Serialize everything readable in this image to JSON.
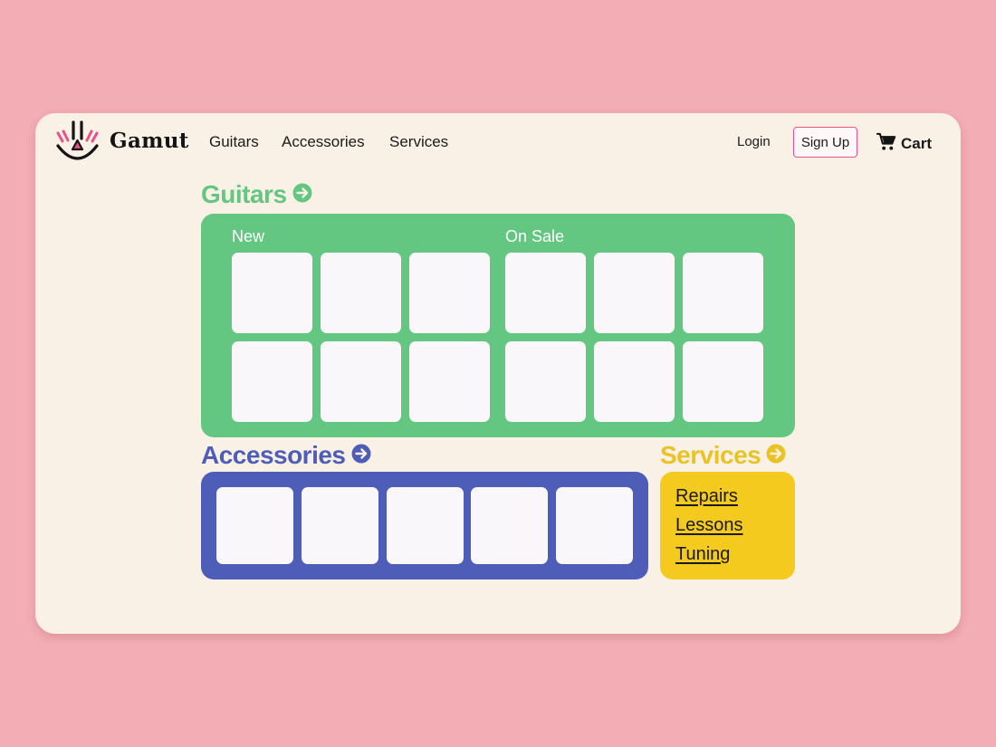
{
  "header": {
    "brand": "Gamut",
    "nav": [
      "Guitars",
      "Accessories",
      "Services"
    ],
    "login_label": "Login",
    "signup_label": "Sign Up",
    "cart_label": "Cart"
  },
  "guitars": {
    "title": "Guitars",
    "groups": [
      "New",
      "On Sale"
    ]
  },
  "accessories": {
    "title": "Accessories"
  },
  "services": {
    "title": "Services",
    "links": [
      "Repairs",
      "Lessons",
      "Tuning"
    ]
  },
  "colors": {
    "page_background": "#F3ADB4",
    "window_background": "#FAF1E6",
    "guitars_green": "#64C781",
    "accessories_blue": "#4E5DB7",
    "services_yellow": "#F4CA1E",
    "signup_border_pink": "#E8518A",
    "tile": "#FAF7FB"
  },
  "icons": {
    "logo": "smiling-face-logo-icon",
    "cart": "shopping-cart-icon",
    "section_arrow": "arrow-right-circle-icon"
  }
}
